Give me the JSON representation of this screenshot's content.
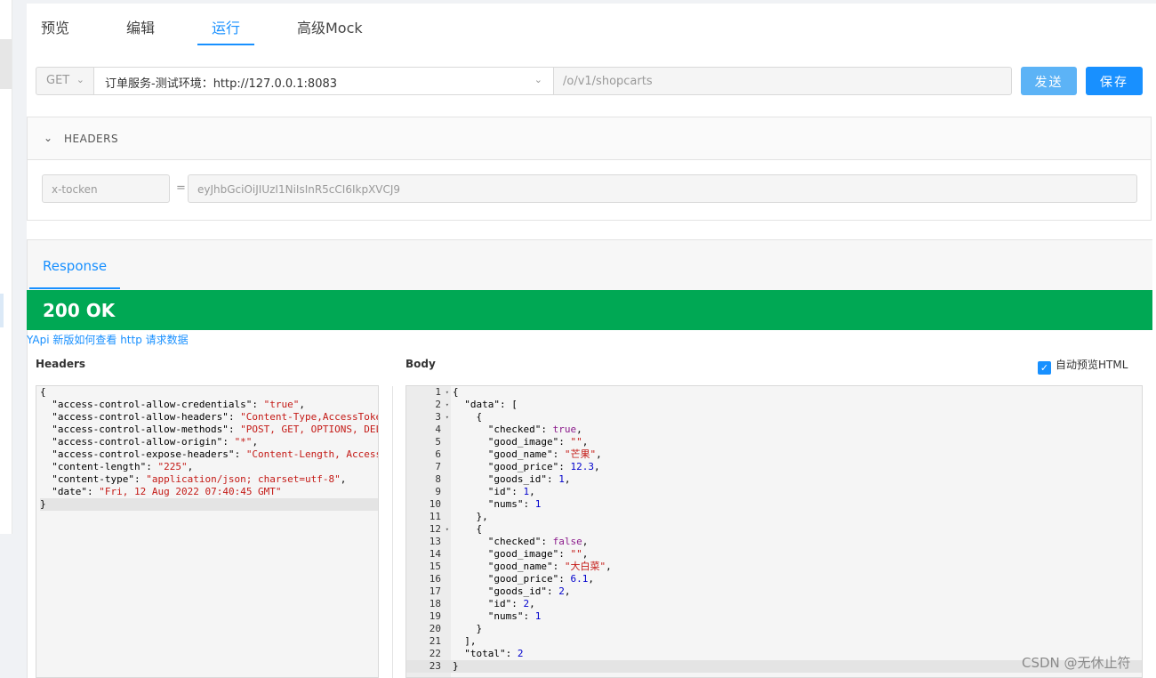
{
  "tabs": {
    "preview": "预览",
    "edit": "编辑",
    "run": "运行",
    "mock": "高级Mock"
  },
  "request": {
    "method": "GET",
    "environment": "订单服务-测试环境：http://127.0.0.1:8083",
    "path": "/o/v1/shopcarts",
    "send_label": "发送",
    "save_label": "保存"
  },
  "headers_section": {
    "title": "HEADERS",
    "key": "x-tocken",
    "equals": "=",
    "value": "eyJhbGciOiJIUzI1NiIsInR5cCI6IkpXVCJ9"
  },
  "response": {
    "tab": "Response",
    "status": "200 OK",
    "help_link": "YApi 新版如何查看 http 请求数据",
    "headers_label": "Headers",
    "body_label": "Body",
    "auto_preview_label": "自动预览HTML",
    "auto_preview_checked": true,
    "headers_lines": [
      [
        [
          "p",
          "{"
        ]
      ],
      [
        [
          "p",
          "  "
        ],
        [
          "k",
          "\"access-control-allow-credentials\""
        ],
        [
          "p",
          ": "
        ],
        [
          "s",
          "\"true\""
        ],
        [
          "p",
          ","
        ]
      ],
      [
        [
          "p",
          "  "
        ],
        [
          "k",
          "\"access-control-allow-headers\""
        ],
        [
          "p",
          ": "
        ],
        [
          "s",
          "\"Content-Type,AccessToke"
        ]
      ],
      [
        [
          "p",
          "  "
        ],
        [
          "k",
          "\"access-control-allow-methods\""
        ],
        [
          "p",
          ": "
        ],
        [
          "s",
          "\"POST, GET, OPTIONS, DEL"
        ]
      ],
      [
        [
          "p",
          "  "
        ],
        [
          "k",
          "\"access-control-allow-origin\""
        ],
        [
          "p",
          ": "
        ],
        [
          "s",
          "\"*\""
        ],
        [
          "p",
          ","
        ]
      ],
      [
        [
          "p",
          "  "
        ],
        [
          "k",
          "\"access-control-expose-headers\""
        ],
        [
          "p",
          ": "
        ],
        [
          "s",
          "\"Content-Length, Access"
        ]
      ],
      [
        [
          "p",
          "  "
        ],
        [
          "k",
          "\"content-length\""
        ],
        [
          "p",
          ": "
        ],
        [
          "s",
          "\"225\""
        ],
        [
          "p",
          ","
        ]
      ],
      [
        [
          "p",
          "  "
        ],
        [
          "k",
          "\"content-type\""
        ],
        [
          "p",
          ": "
        ],
        [
          "s",
          "\"application/json; charset=utf-8\""
        ],
        [
          "p",
          ","
        ]
      ],
      [
        [
          "p",
          "  "
        ],
        [
          "k",
          "\"date\""
        ],
        [
          "p",
          ": "
        ],
        [
          "s",
          "\"Fri, 12 Aug 2022 07:40:45 GMT\""
        ]
      ],
      [
        [
          "p",
          "}"
        ]
      ]
    ],
    "body_lines": [
      {
        "n": "1",
        "fold": true,
        "t": [
          [
            "p",
            "{"
          ]
        ]
      },
      {
        "n": "2",
        "fold": true,
        "t": [
          [
            "p",
            "  "
          ],
          [
            "k",
            "\"data\""
          ],
          [
            "p",
            ": ["
          ]
        ]
      },
      {
        "n": "3",
        "fold": true,
        "t": [
          [
            "p",
            "    {"
          ]
        ]
      },
      {
        "n": "4",
        "t": [
          [
            "p",
            "      "
          ],
          [
            "k",
            "\"checked\""
          ],
          [
            "p",
            ": "
          ],
          [
            "b",
            "true"
          ],
          [
            "p",
            ","
          ]
        ]
      },
      {
        "n": "5",
        "t": [
          [
            "p",
            "      "
          ],
          [
            "k",
            "\"good_image\""
          ],
          [
            "p",
            ": "
          ],
          [
            "s",
            "\"\""
          ],
          [
            "p",
            ","
          ]
        ]
      },
      {
        "n": "6",
        "t": [
          [
            "p",
            "      "
          ],
          [
            "k",
            "\"good_name\""
          ],
          [
            "p",
            ": "
          ],
          [
            "s",
            "\"芒果\""
          ],
          [
            "p",
            ","
          ]
        ]
      },
      {
        "n": "7",
        "t": [
          [
            "p",
            "      "
          ],
          [
            "k",
            "\"good_price\""
          ],
          [
            "p",
            ": "
          ],
          [
            "n",
            "12.3"
          ],
          [
            "p",
            ","
          ]
        ]
      },
      {
        "n": "8",
        "t": [
          [
            "p",
            "      "
          ],
          [
            "k",
            "\"goods_id\""
          ],
          [
            "p",
            ": "
          ],
          [
            "n",
            "1"
          ],
          [
            "p",
            ","
          ]
        ]
      },
      {
        "n": "9",
        "t": [
          [
            "p",
            "      "
          ],
          [
            "k",
            "\"id\""
          ],
          [
            "p",
            ": "
          ],
          [
            "n",
            "1"
          ],
          [
            "p",
            ","
          ]
        ]
      },
      {
        "n": "10",
        "t": [
          [
            "p",
            "      "
          ],
          [
            "k",
            "\"nums\""
          ],
          [
            "p",
            ": "
          ],
          [
            "n",
            "1"
          ]
        ]
      },
      {
        "n": "11",
        "t": [
          [
            "p",
            "    },"
          ]
        ]
      },
      {
        "n": "12",
        "fold": true,
        "t": [
          [
            "p",
            "    {"
          ]
        ]
      },
      {
        "n": "13",
        "t": [
          [
            "p",
            "      "
          ],
          [
            "k",
            "\"checked\""
          ],
          [
            "p",
            ": "
          ],
          [
            "b",
            "false"
          ],
          [
            "p",
            ","
          ]
        ]
      },
      {
        "n": "14",
        "t": [
          [
            "p",
            "      "
          ],
          [
            "k",
            "\"good_image\""
          ],
          [
            "p",
            ": "
          ],
          [
            "s",
            "\"\""
          ],
          [
            "p",
            ","
          ]
        ]
      },
      {
        "n": "15",
        "t": [
          [
            "p",
            "      "
          ],
          [
            "k",
            "\"good_name\""
          ],
          [
            "p",
            ": "
          ],
          [
            "s",
            "\"大白菜\""
          ],
          [
            "p",
            ","
          ]
        ]
      },
      {
        "n": "16",
        "t": [
          [
            "p",
            "      "
          ],
          [
            "k",
            "\"good_price\""
          ],
          [
            "p",
            ": "
          ],
          [
            "n",
            "6.1"
          ],
          [
            "p",
            ","
          ]
        ]
      },
      {
        "n": "17",
        "t": [
          [
            "p",
            "      "
          ],
          [
            "k",
            "\"goods_id\""
          ],
          [
            "p",
            ": "
          ],
          [
            "n",
            "2"
          ],
          [
            "p",
            ","
          ]
        ]
      },
      {
        "n": "18",
        "t": [
          [
            "p",
            "      "
          ],
          [
            "k",
            "\"id\""
          ],
          [
            "p",
            ": "
          ],
          [
            "n",
            "2"
          ],
          [
            "p",
            ","
          ]
        ]
      },
      {
        "n": "19",
        "t": [
          [
            "p",
            "      "
          ],
          [
            "k",
            "\"nums\""
          ],
          [
            "p",
            ": "
          ],
          [
            "n",
            "1"
          ]
        ]
      },
      {
        "n": "20",
        "t": [
          [
            "p",
            "    }"
          ]
        ]
      },
      {
        "n": "21",
        "t": [
          [
            "p",
            "  ],"
          ]
        ]
      },
      {
        "n": "22",
        "t": [
          [
            "p",
            "  "
          ],
          [
            "k",
            "\"total\""
          ],
          [
            "p",
            ": "
          ],
          [
            "n",
            "2"
          ]
        ]
      },
      {
        "n": "23",
        "hl": true,
        "t": [
          [
            "p",
            "}"
          ]
        ]
      }
    ]
  },
  "watermark": "CSDN @无休止符"
}
